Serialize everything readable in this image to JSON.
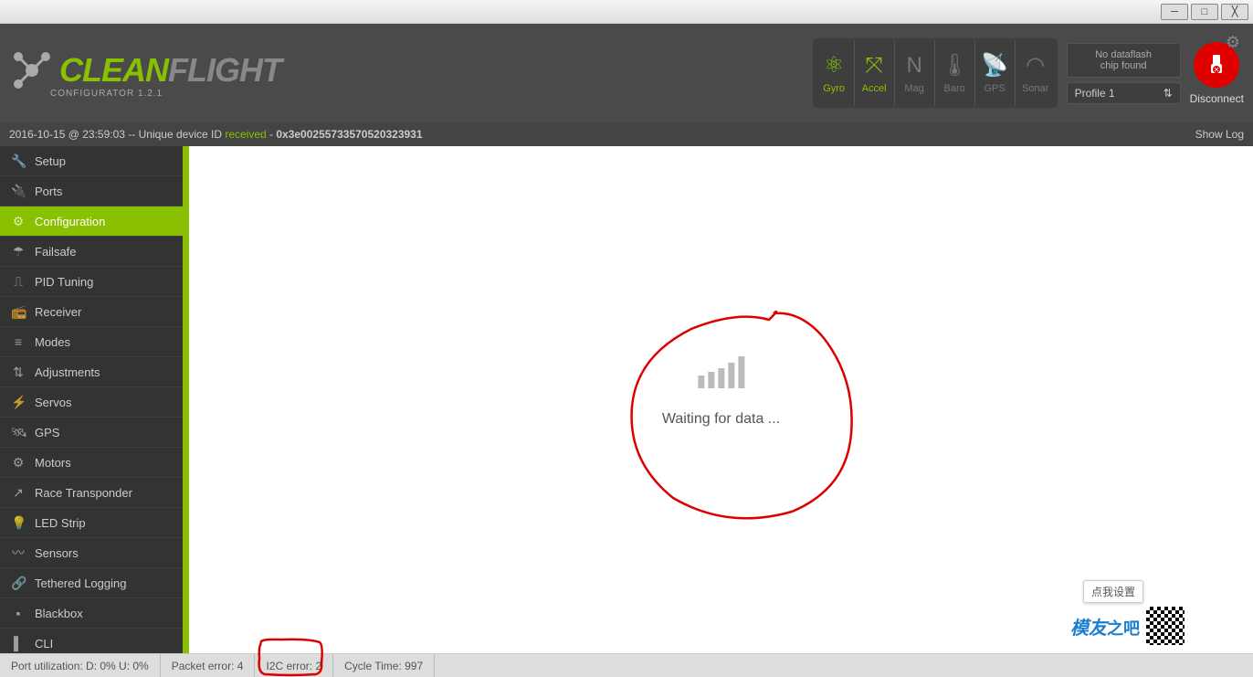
{
  "window": {
    "min": "─",
    "max": "□",
    "close": "╳"
  },
  "logo": {
    "brand1": "CLEAN",
    "brand2": "FLIGHT",
    "sub": "CONFIGURATOR  1.2.1"
  },
  "sensors": [
    {
      "icon": "⚛",
      "label": "Gyro",
      "on": true
    },
    {
      "icon": "⤧",
      "label": "Accel",
      "on": true
    },
    {
      "icon": "N",
      "label": "Mag",
      "on": false
    },
    {
      "icon": "🌡",
      "label": "Baro",
      "on": false
    },
    {
      "icon": "📡",
      "label": "GPS",
      "on": false
    },
    {
      "icon": "◠",
      "label": "Sonar",
      "on": false
    }
  ],
  "dataflash": {
    "line1": "No dataflash",
    "line2": "chip found"
  },
  "profile": {
    "label": "Profile 1"
  },
  "disconnect": "Disconnect",
  "log": {
    "ts": "2016-10-15 @ 23:59:03 -- Unique device ID ",
    "status": "received",
    "suffix": " - ",
    "id": "0x3e00255733570520323931",
    "showlog": "Show Log"
  },
  "nav": [
    {
      "icon": "🔧",
      "label": "Setup"
    },
    {
      "icon": "🔌",
      "label": "Ports"
    },
    {
      "icon": "⚙",
      "label": "Configuration",
      "active": true
    },
    {
      "icon": "☂",
      "label": "Failsafe"
    },
    {
      "icon": "⎍",
      "label": "PID Tuning"
    },
    {
      "icon": "📻",
      "label": "Receiver"
    },
    {
      "icon": "≡",
      "label": "Modes"
    },
    {
      "icon": "⇅",
      "label": "Adjustments"
    },
    {
      "icon": "⚡",
      "label": "Servos"
    },
    {
      "icon": "🛰",
      "label": "GPS"
    },
    {
      "icon": "⚙",
      "label": "Motors"
    },
    {
      "icon": "↗",
      "label": "Race Transponder"
    },
    {
      "icon": "💡",
      "label": "LED Strip"
    },
    {
      "icon": "〰",
      "label": "Sensors"
    },
    {
      "icon": "🔗",
      "label": "Tethered Logging"
    },
    {
      "icon": "▪",
      "label": "Blackbox"
    },
    {
      "icon": "▌",
      "label": "CLI"
    }
  ],
  "main": {
    "waiting": "Waiting for data ..."
  },
  "footer": {
    "port": "Port utilization: D: 0% U: 0%",
    "packet": "Packet error: 4",
    "i2c": "I2C error: 2",
    "cycle": "Cycle Time: 997"
  },
  "tooltip": "点我设置",
  "watermark": {
    "t1": "模友",
    "t2": "之吧"
  }
}
